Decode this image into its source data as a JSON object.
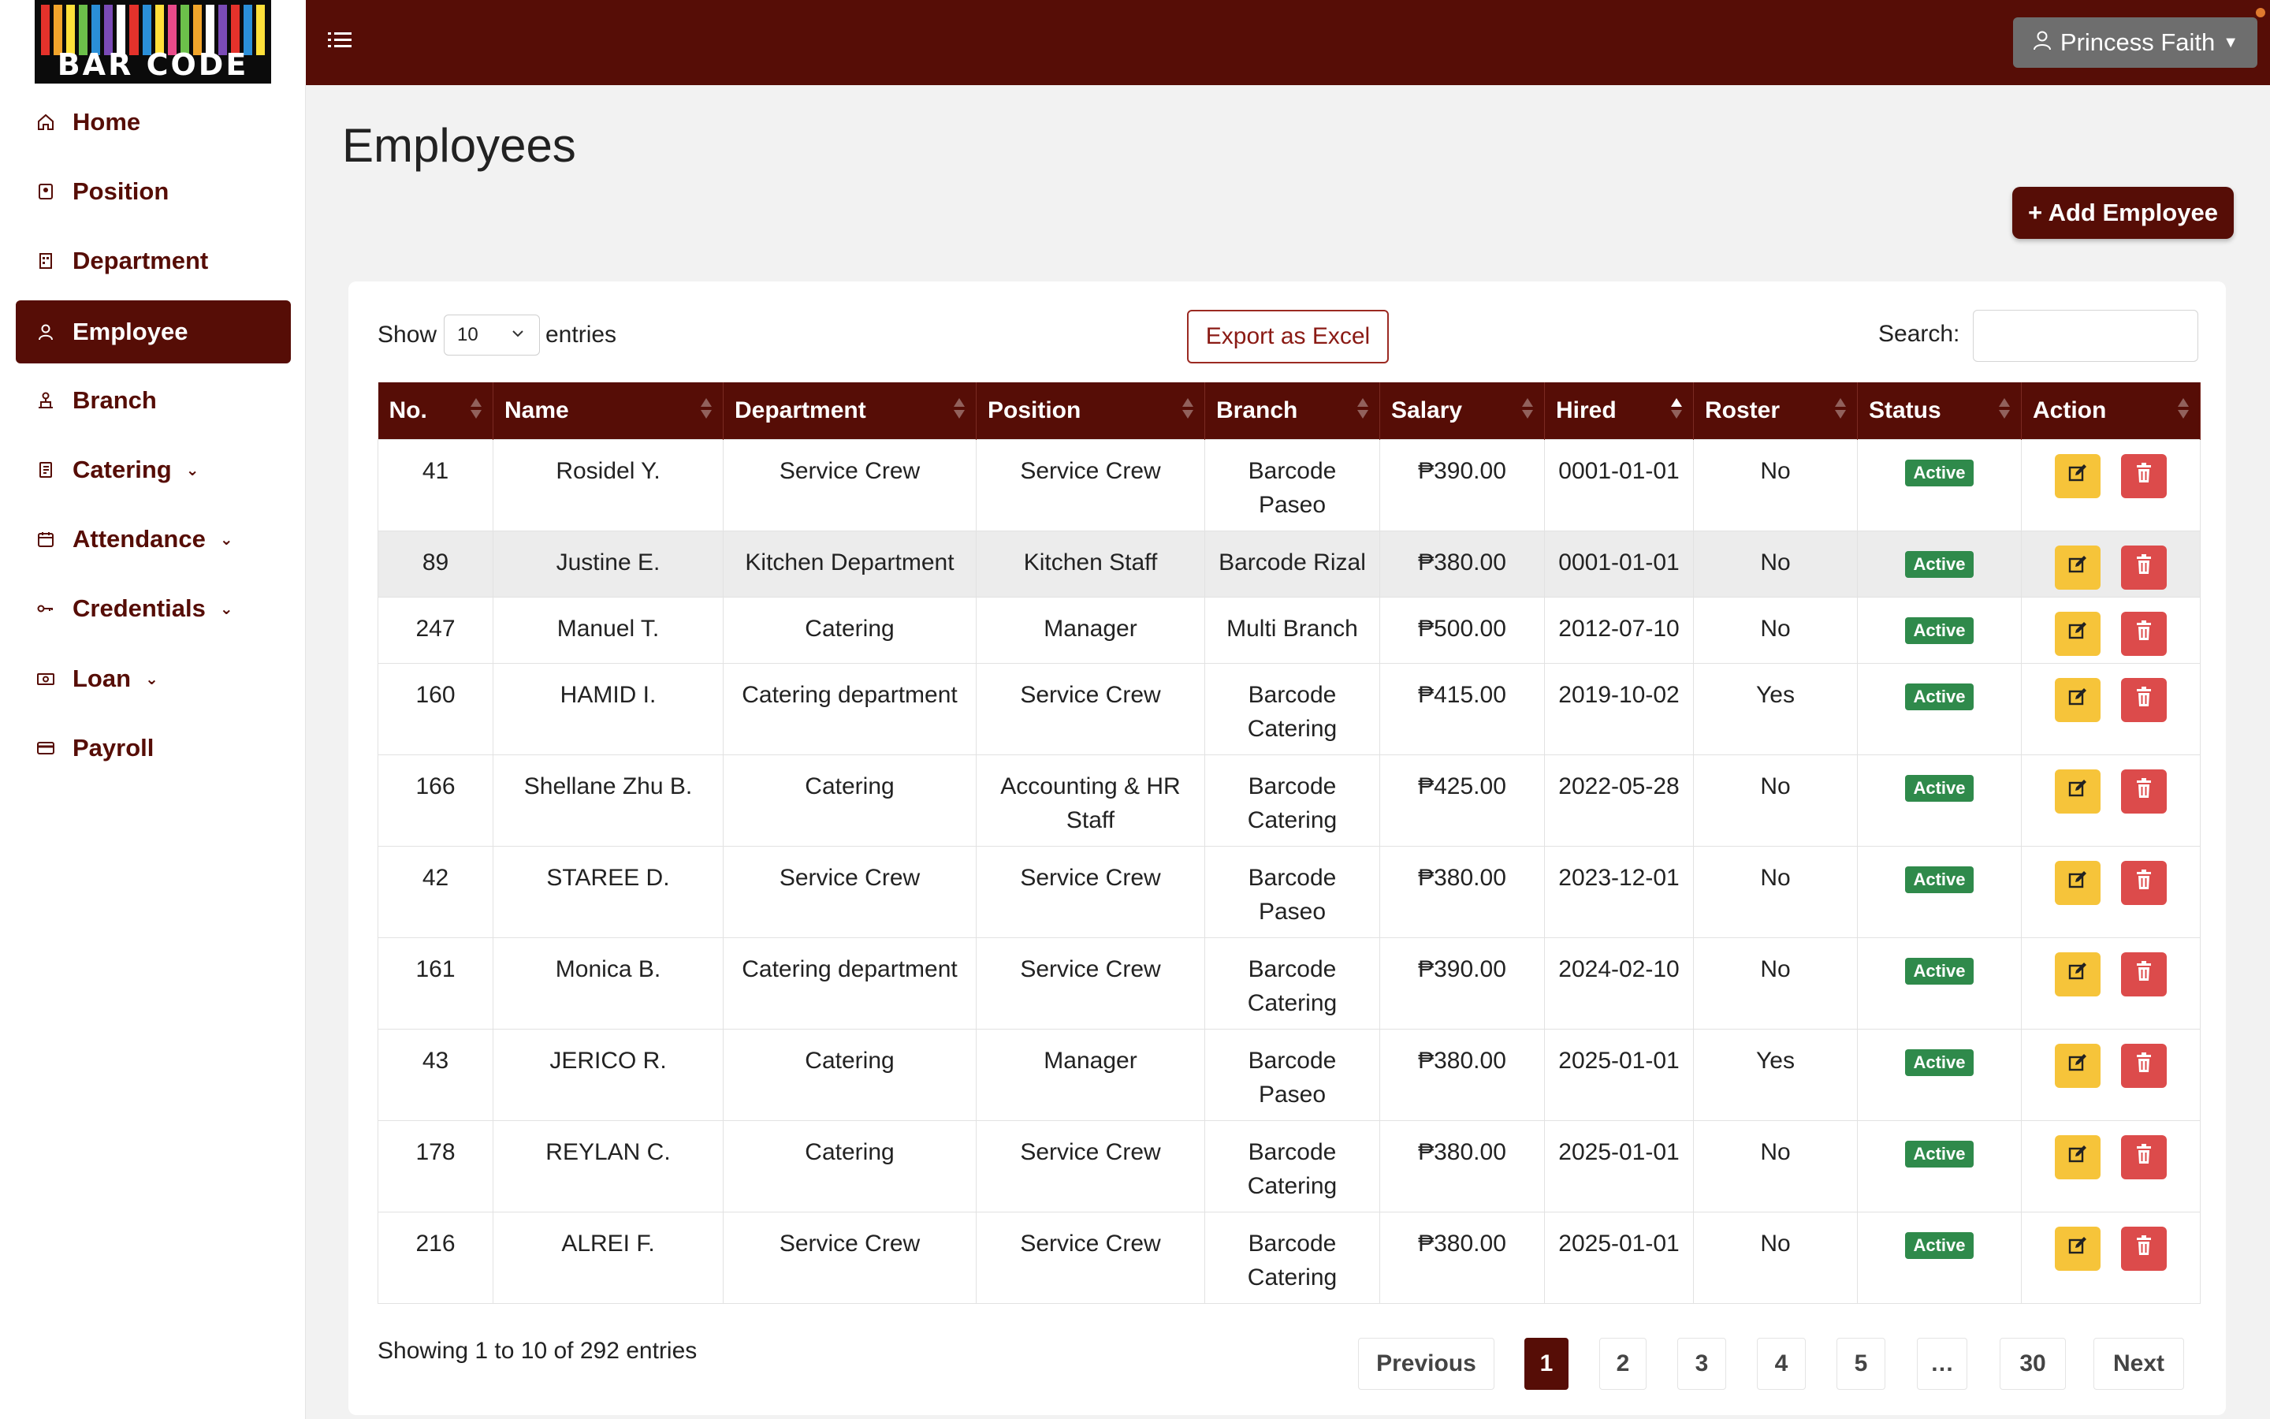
{
  "logo": {
    "text": "BAR CODE"
  },
  "header": {
    "user_name": "Princess Faith"
  },
  "sidebar": {
    "items": [
      {
        "label": "Home"
      },
      {
        "label": "Position"
      },
      {
        "label": "Department"
      },
      {
        "label": "Employee"
      },
      {
        "label": "Branch"
      },
      {
        "label": "Catering"
      },
      {
        "label": "Attendance"
      },
      {
        "label": "Credentials"
      },
      {
        "label": "Loan"
      },
      {
        "label": "Payroll"
      }
    ]
  },
  "page": {
    "title": "Employees",
    "add_button": "+ Add Employee"
  },
  "controls": {
    "show_label": "Show",
    "entries_value": "10",
    "entries_label": "entries",
    "export_label": "Export as Excel",
    "search_label": "Search:",
    "search_value": ""
  },
  "table": {
    "columns": [
      "No.",
      "Name",
      "Department",
      "Position",
      "Branch",
      "Salary",
      "Hired",
      "Roster",
      "Status",
      "Action"
    ],
    "sorted_column": "Hired",
    "rows": [
      {
        "no": "41",
        "name": "Rosidel Y.",
        "department": "Service Crew",
        "position": "Service Crew",
        "branch": "Barcode Paseo",
        "salary": "₱390.00",
        "hired": "0001-01-01",
        "roster": "No",
        "status": "Active"
      },
      {
        "no": "89",
        "name": "Justine E.",
        "department": "Kitchen Department",
        "position": "Kitchen Staff",
        "branch": "Barcode Rizal",
        "salary": "₱380.00",
        "hired": "0001-01-01",
        "roster": "No",
        "status": "Active"
      },
      {
        "no": "247",
        "name": "Manuel T.",
        "department": "Catering",
        "position": "Manager",
        "branch": "Multi Branch",
        "salary": "₱500.00",
        "hired": "2012-07-10",
        "roster": "No",
        "status": "Active"
      },
      {
        "no": "160",
        "name": "HAMID I.",
        "department": "Catering department",
        "position": "Service Crew",
        "branch": "Barcode Catering",
        "salary": "₱415.00",
        "hired": "2019-10-02",
        "roster": "Yes",
        "status": "Active"
      },
      {
        "no": "166",
        "name": "Shellane Zhu B.",
        "department": "Catering",
        "position": "Accounting & HR Staff",
        "branch": "Barcode Catering",
        "salary": "₱425.00",
        "hired": "2022-05-28",
        "roster": "No",
        "status": "Active"
      },
      {
        "no": "42",
        "name": "STAREE D.",
        "department": "Service Crew",
        "position": "Service Crew",
        "branch": "Barcode Paseo",
        "salary": "₱380.00",
        "hired": "2023-12-01",
        "roster": "No",
        "status": "Active"
      },
      {
        "no": "161",
        "name": "Monica B.",
        "department": "Catering department",
        "position": "Service Crew",
        "branch": "Barcode Catering",
        "salary": "₱390.00",
        "hired": "2024-02-10",
        "roster": "No",
        "status": "Active"
      },
      {
        "no": "43",
        "name": "JERICO R.",
        "department": "Catering",
        "position": "Manager",
        "branch": "Barcode Paseo",
        "salary": "₱380.00",
        "hired": "2025-01-01",
        "roster": "Yes",
        "status": "Active"
      },
      {
        "no": "178",
        "name": "REYLAN C.",
        "department": "Catering",
        "position": "Service Crew",
        "branch": "Barcode Catering",
        "salary": "₱380.00",
        "hired": "2025-01-01",
        "roster": "No",
        "status": "Active"
      },
      {
        "no": "216",
        "name": "ALREI F.",
        "department": "Service Crew",
        "position": "Service Crew",
        "branch": "Barcode Catering",
        "salary": "₱380.00",
        "hired": "2025-01-01",
        "roster": "No",
        "status": "Active"
      }
    ]
  },
  "footer": {
    "showing_text": "Showing 1 to 10 of 292 entries",
    "previous_label": "Previous",
    "next_label": "Next",
    "pages": [
      "1",
      "2",
      "3",
      "4",
      "5",
      "…",
      "30"
    ],
    "current_page": "1"
  },
  "colors": {
    "brand": "#560d06",
    "status_active": "#2f8a4b",
    "edit": "#f6c43a",
    "delete": "#dc4b4b"
  }
}
